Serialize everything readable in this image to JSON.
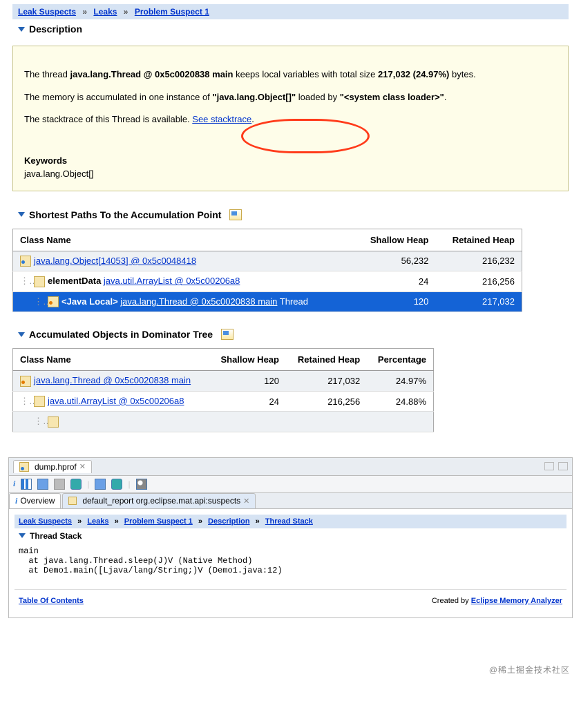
{
  "breadcrumb1": {
    "items": [
      "Leak Suspects",
      "Leaks",
      "Problem Suspect 1"
    ],
    "sep": "»"
  },
  "description": {
    "title": "Description",
    "p1_pre": "The thread ",
    "p1_bold1": "java.lang.Thread @ 0x5c0020838 main",
    "p1_mid": " keeps local variables with total size ",
    "p1_bold2": "217,032 (24.97%)",
    "p1_end": " bytes.",
    "p2_pre": "The memory is accumulated in one instance of ",
    "p2_bold1": "\"java.lang.Object[]\"",
    "p2_mid": " loaded by ",
    "p2_bold2": "\"<system class loader>\"",
    "p2_end": ".",
    "p3_pre": "The stacktrace of this Thread is available. ",
    "p3_link": "See stacktrace",
    "p3_end": ".",
    "keywords_label": "Keywords",
    "keywords_value": "java.lang.Object[]"
  },
  "shortest_paths": {
    "title": "Shortest Paths To the Accumulation Point",
    "headers": [
      "Class Name",
      "Shallow Heap",
      "Retained Heap"
    ],
    "rows": [
      {
        "indent": 0,
        "icon": "blue",
        "pre": "",
        "link": "java.lang.Object[14053] @ 0x5c0048418",
        "post": "",
        "shallow": "56,232",
        "retained": "216,232",
        "sel": false
      },
      {
        "indent": 1,
        "icon": "plain",
        "pre": "elementData ",
        "link": "java.util.ArrayList @ 0x5c00206a8",
        "post": "",
        "shallow": "24",
        "retained": "216,256",
        "sel": false
      },
      {
        "indent": 2,
        "icon": "orange",
        "pre": "<Java Local> ",
        "link": "java.lang.Thread @ 0x5c0020838 main",
        "post": " Thread",
        "shallow": "120",
        "retained": "217,032",
        "sel": true
      }
    ]
  },
  "dominator": {
    "title": "Accumulated Objects in Dominator Tree",
    "headers": [
      "Class Name",
      "Shallow Heap",
      "Retained Heap",
      "Percentage"
    ],
    "rows": [
      {
        "indent": 0,
        "icon": "orange",
        "link": "java.lang.Thread @ 0x5c0020838 main",
        "shallow": "120",
        "retained": "217,032",
        "pct": "24.97%"
      },
      {
        "indent": 1,
        "icon": "plain",
        "link": "java.util.ArrayList @ 0x5c00206a8",
        "shallow": "24",
        "retained": "216,256",
        "pct": "24.88%"
      }
    ]
  },
  "panel2": {
    "file_tab": "dump.hprof",
    "subtab_overview": "Overview",
    "subtab_report": "default_report  org.eclipse.mat.api:suspects",
    "breadcrumb": [
      "Leak Suspects",
      "Leaks",
      "Problem Suspect 1",
      "Description",
      "Thread Stack"
    ],
    "sep": "»",
    "section_title": "Thread Stack",
    "stack": "main\n  at java.lang.Thread.sleep(J)V (Native Method)\n  at Demo1.main([Ljava/lang/String;)V (Demo1.java:12)",
    "toc": "Table Of Contents",
    "created_by_pre": "Created by ",
    "created_by_link": "Eclipse Memory Analyzer",
    "info_i": "i"
  },
  "watermark": "@稀土掘金技术社区"
}
